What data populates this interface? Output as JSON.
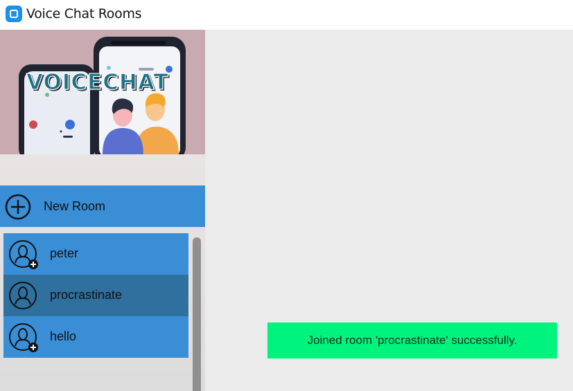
{
  "window": {
    "title": "Voice Chat Rooms",
    "icon": "app-icon"
  },
  "banner": {
    "logo_text": "VOICECHAT",
    "image": "voice-chat-illustration"
  },
  "sidebar": {
    "new_room_label": "New Room",
    "new_room_icon": "plus-circle-icon",
    "rooms": [
      {
        "label": "peter",
        "icon": "user-add-icon",
        "selected": false
      },
      {
        "label": "procrastinate",
        "icon": "user-icon",
        "selected": true
      },
      {
        "label": "hello",
        "icon": "user-add-icon",
        "selected": false
      }
    ]
  },
  "toast": {
    "message": "Joined room 'procrastinate' successfully."
  },
  "colors": {
    "accent": "#3a8ed6",
    "selected": "#30709e",
    "toast": "#00f47d",
    "background": "#ebebeb"
  }
}
